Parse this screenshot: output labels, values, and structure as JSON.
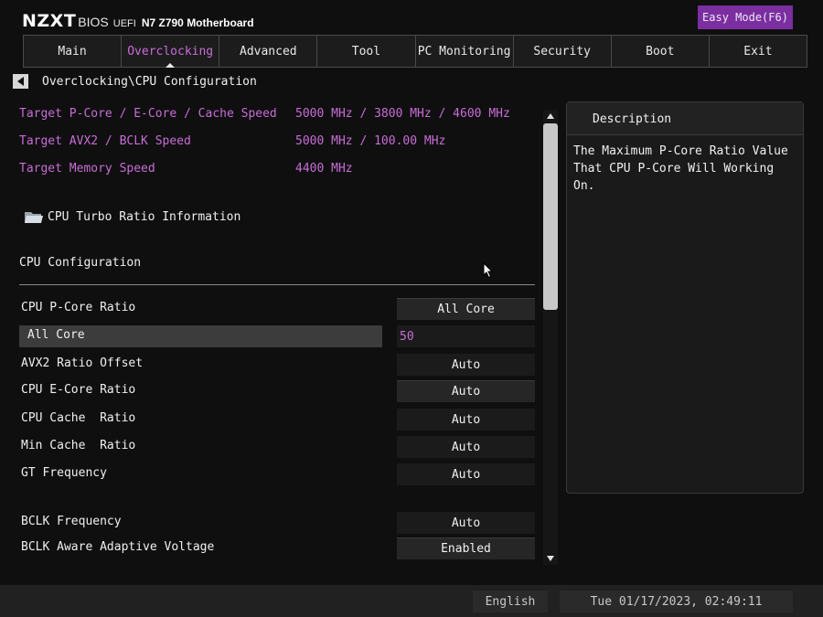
{
  "header": {
    "brand": "NZXT",
    "bios": "BIOS",
    "uefi": "UEFI",
    "model": "N7 Z790 Motherboard",
    "easy_mode": "Easy Mode(F6)"
  },
  "nav": {
    "tabs": [
      "Main",
      "Overclocking",
      "Advanced",
      "Tool",
      "PC Monitoring",
      "Security",
      "Boot",
      "Exit"
    ],
    "active": "Overclocking"
  },
  "breadcrumb": "Overclocking\\CPU Configuration",
  "targets": [
    {
      "label": "Target P-Core / E-Core / Cache Speed",
      "value": "5000 MHz / 3800 MHz / 4600 MHz"
    },
    {
      "label": "Target AVX2 / BCLK Speed",
      "value": "5000 MHz / 100.00 MHz"
    },
    {
      "label": "Target Memory Speed",
      "value": "4400 MHz"
    }
  ],
  "submenu": {
    "label": "CPU Turbo Ratio Information",
    "icon": "folder-icon"
  },
  "section_title": "CPU Configuration",
  "settings": [
    {
      "label": "CPU P-Core Ratio",
      "value": "All Core"
    },
    {
      "label": "All Core",
      "value": "50"
    },
    {
      "label": "AVX2 Ratio Offset",
      "value": "Auto"
    },
    {
      "label": "CPU E-Core Ratio",
      "value": "Auto"
    },
    {
      "label": "CPU Cache  Ratio",
      "value": "Auto"
    },
    {
      "label": "Min Cache  Ratio",
      "value": "Auto"
    },
    {
      "label": "GT Frequency",
      "value": "Auto"
    },
    {
      "label": "BCLK Frequency",
      "value": "Auto"
    },
    {
      "label": "BCLK Aware Adaptive Voltage",
      "value": "Enabled"
    }
  ],
  "description": {
    "title": "Description",
    "text": "The Maximum P-Core Ratio Value\nThat CPU P-Core Will Working On."
  },
  "footer": {
    "language": "English",
    "datetime": "Tue 01/17/2023, 02:49:11"
  },
  "colors": {
    "accent": "#c86dd7",
    "easy_mode_bg": "#7a2ea0",
    "background": "#0f0f0f"
  }
}
